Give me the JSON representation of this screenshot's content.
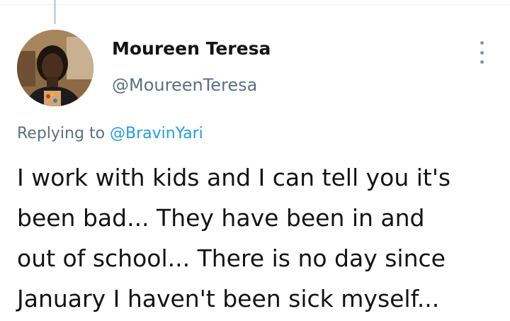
{
  "tweet": {
    "author_name": "Moureen Teresa",
    "author_handle": "@MoureenTeresa",
    "replying_prefix": "Replying to",
    "replying_mention": "@BravinYari",
    "body_lines": [
      "I work with kids and I can tell you it's",
      "been bad... They have been in and",
      "out of school... There is no day since",
      "January I haven't been sick myself..."
    ]
  },
  "icons": {
    "more": "more-vertical-icon",
    "avatar": "avatar-photo"
  },
  "colors": {
    "name": "#141414",
    "handle": "#5b7083",
    "mention": "#1d9bf0",
    "thread_line": "#c9d3dc"
  }
}
